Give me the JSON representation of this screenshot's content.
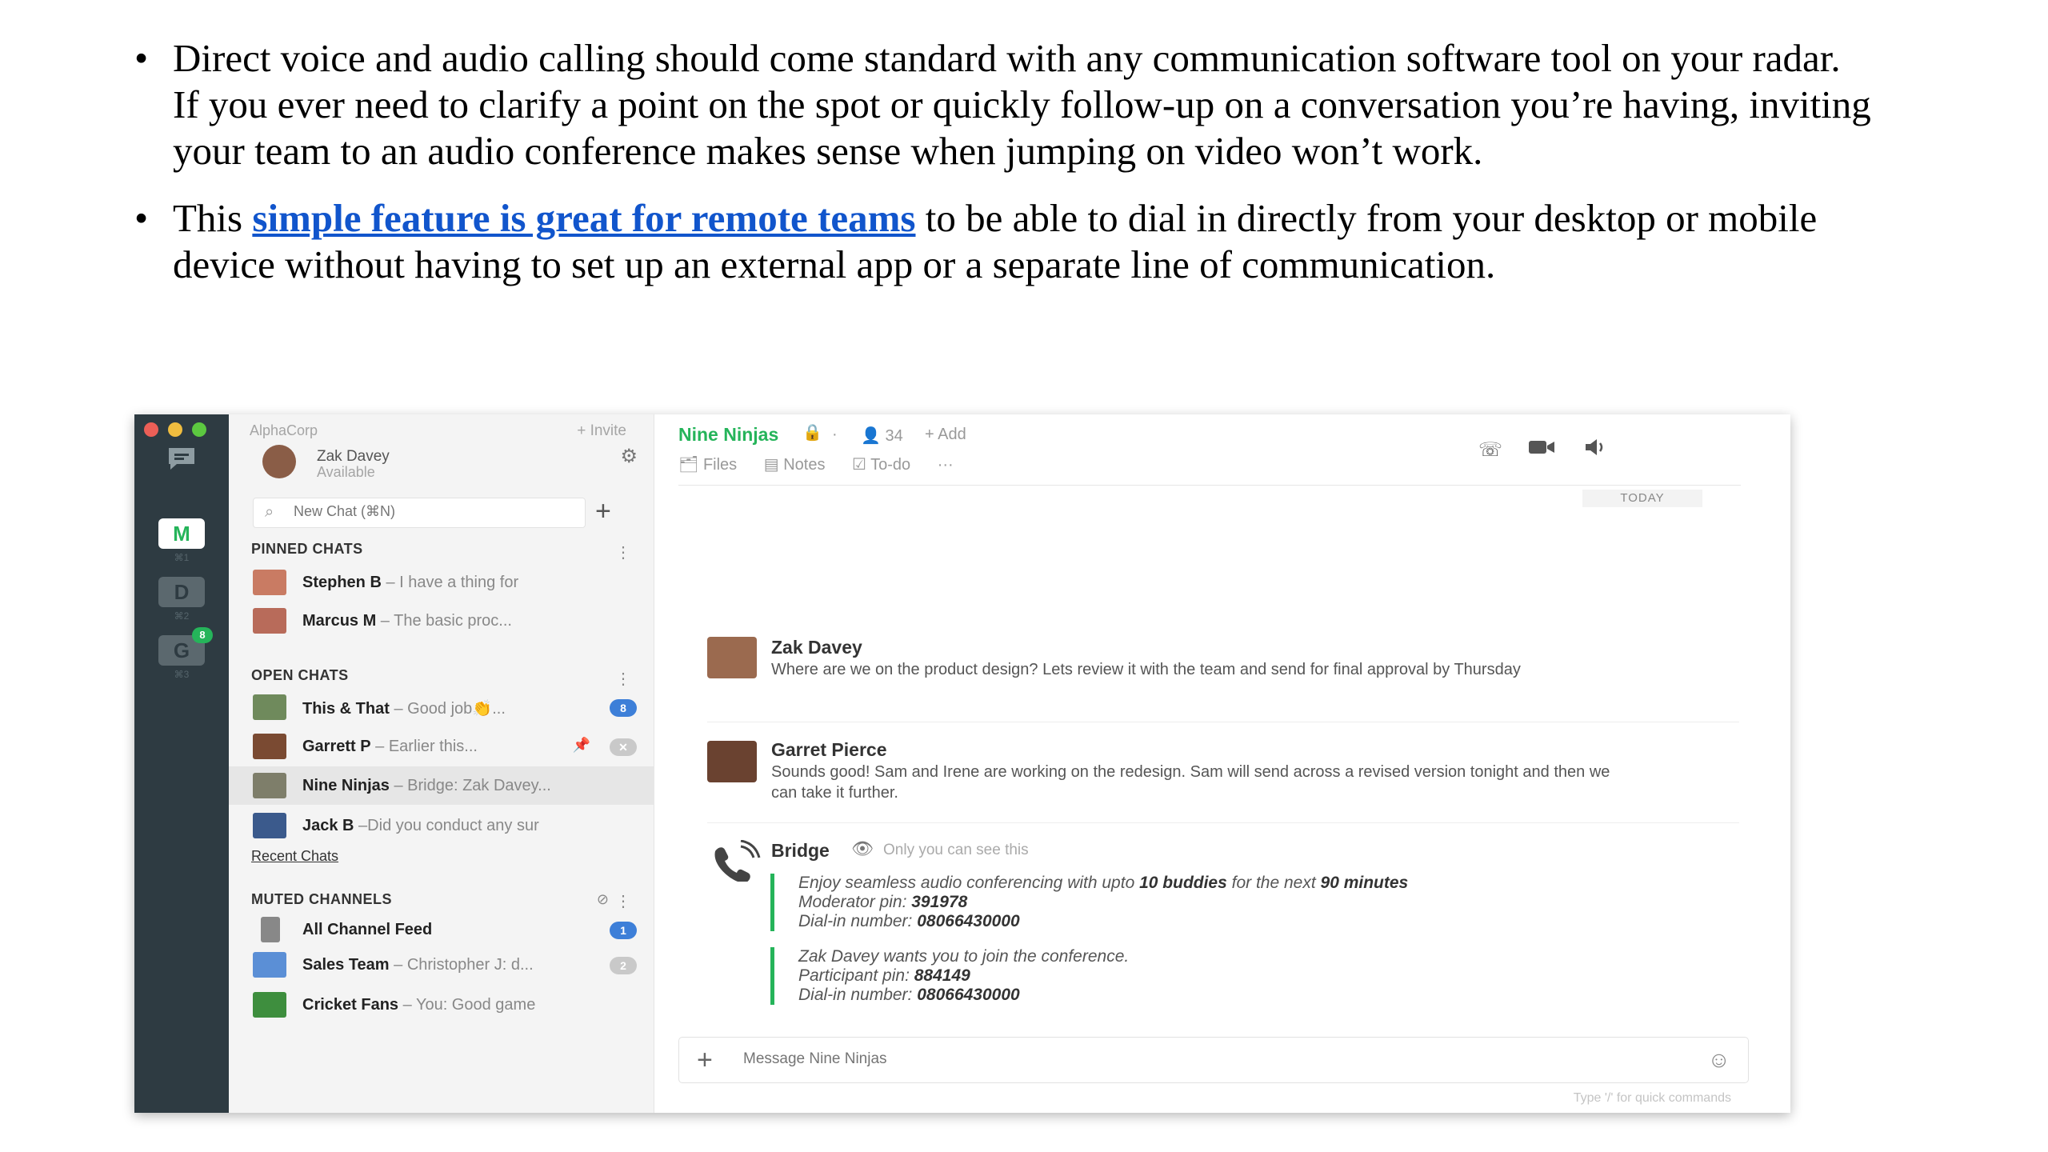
{
  "document": {
    "bullet_1": "Direct voice and audio calling should come standard with any communication software tool on your radar. If you ever need to clarify a point on the spot or quickly follow-up on a conversation you’re having, inviting your team to an audio conference makes sense when jumping on video won’t work.",
    "bullet_2_prefix": "This ",
    "bullet_2_link": "simple feature is great for remote teams",
    "bullet_2_suffix": " to be able to dial in directly from your desktop or mobile device without having to set up an external app or a separate line of communication."
  },
  "rail": {
    "workspaces": [
      {
        "letter": "M",
        "shortcut": "⌘1"
      },
      {
        "letter": "D",
        "shortcut": "⌘2"
      },
      {
        "letter": "G",
        "shortcut": "⌘3",
        "badge": "8"
      }
    ]
  },
  "sidebar": {
    "org": "AlphaCorp",
    "invite": "+ Invite",
    "user_name": "Zak Davey",
    "user_status": "Available",
    "search_placeholder": "New Chat (⌘N)",
    "pinned_title": "PINNED CHATS",
    "pinned": [
      {
        "name": "Stephen B",
        "preview": " – I have a thing for",
        "color": "#c97b63"
      },
      {
        "name": "Marcus M",
        "preview": " – The basic proc...",
        "color": "#b86b5a"
      }
    ],
    "open_title": "OPEN CHATS",
    "open": [
      {
        "name": "This & That",
        "preview": " – Good job👏...",
        "badge": "8",
        "color": "#6f8a5c"
      },
      {
        "name": "Garrett P",
        "preview": " – Earlier this...",
        "badge": "",
        "color": "#7a4a32"
      },
      {
        "name": "Nine Ninjas",
        "preview": " – Bridge: Zak Davey...",
        "color": "#7e7e6a"
      },
      {
        "name": "Jack B",
        "preview": " –Did you conduct any sur",
        "color": "#3b5a8c"
      }
    ],
    "recent": "Recent Chats",
    "muted_title": "MUTED CHANNELS",
    "muted": [
      {
        "name": "All Channel Feed",
        "preview": "",
        "badge": "1",
        "color": "#888888"
      },
      {
        "name": "Sales Team",
        "preview": " – Christopher J: d...",
        "badge": "2",
        "color": "#5b8fd6"
      },
      {
        "name": "Cricket Fans",
        "preview": " – You: Good game",
        "color": "#3e8e3e"
      }
    ]
  },
  "chat": {
    "channel": "Nine Ninjas",
    "members": "34",
    "add": "+ Add",
    "tabs": [
      "Files",
      "Notes",
      "To-do",
      "···"
    ],
    "today": "TODAY",
    "messages": [
      {
        "name": "Zak Davey",
        "text": "Where are we on the product design? Lets review it with the team and send for final approval by Thursday"
      },
      {
        "name": "Garret Pierce",
        "text": "Sounds good! Sam and Irene are working on the redesign. Sam will send across a revised version tonight and then we can take it further."
      }
    ],
    "bridge": {
      "name": "Bridge",
      "note": "Only you can see this",
      "block1_line1_a": "Enjoy seamless audio conferencing with upto ",
      "block1_line1_b": "10 buddies",
      "block1_line1_c": " for the next ",
      "block1_line1_d": "90 minutes",
      "moderator_label": "Moderator pin: ",
      "moderator_pin": "391978",
      "dialin_label": "Dial-in number: ",
      "dialin_number": "08066430000",
      "block2_line1": "Zak Davey wants you to join the conference.",
      "participant_label": "Participant pin: ",
      "participant_pin": "884149"
    },
    "composer_placeholder": "Message Nine Ninjas",
    "hint": "Type '/' for quick commands"
  },
  "colors": {
    "brand_green": "#25b45a",
    "rail": "#2e3b42",
    "link": "#1155cc",
    "badge_blue": "#3d7fd8"
  }
}
